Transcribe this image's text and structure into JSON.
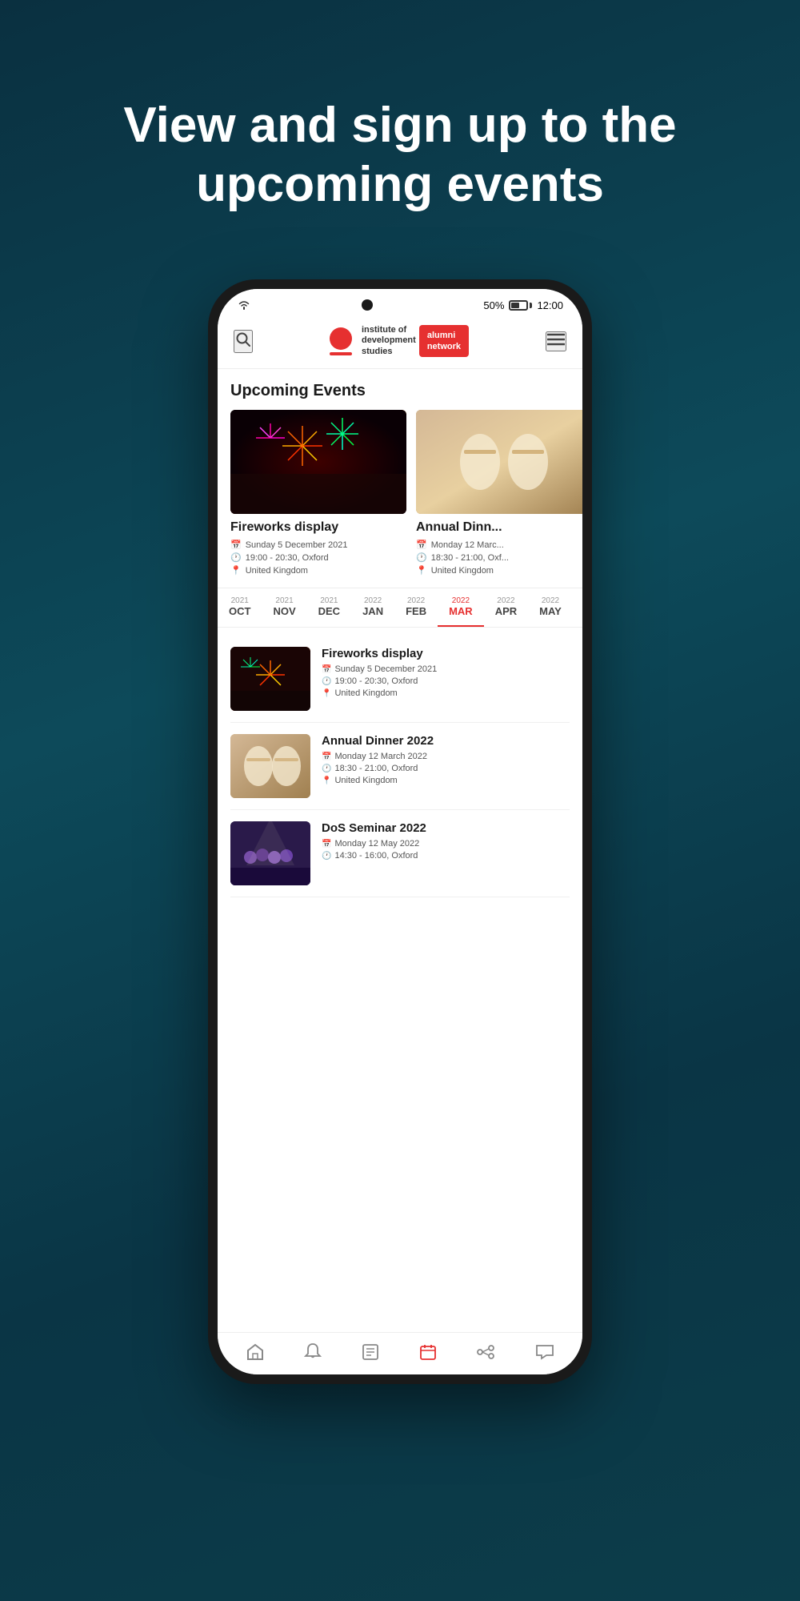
{
  "background": {
    "gradient_start": "#0a3040",
    "gradient_end": "#0c3d4a"
  },
  "hero": {
    "heading": "View and sign up to the upcoming events"
  },
  "status_bar": {
    "time": "12:00",
    "battery": "50%"
  },
  "header": {
    "logo_line1": "institute of",
    "logo_line2": "development",
    "logo_line3": "studies",
    "alumni_line1": "alumni",
    "alumni_line2": "network"
  },
  "upcoming_section": {
    "title": "Upcoming Events"
  },
  "cards": [
    {
      "id": "fireworks",
      "title": "Fireworks display",
      "date": "Sunday 5 December 2021",
      "time_location": "19:00 - 20:30, Oxford",
      "country": "United Kingdom",
      "image_type": "fireworks"
    },
    {
      "id": "annual-dinner",
      "title": "Annual Dinn...",
      "date": "Monday 12 Marc...",
      "time_location": "18:30 - 21:00, Oxf...",
      "country": "United Kingdom",
      "image_type": "dinner"
    }
  ],
  "months": [
    {
      "year": "2021",
      "name": "OCT",
      "active": false
    },
    {
      "year": "2021",
      "name": "NOV",
      "active": false
    },
    {
      "year": "2021",
      "name": "DEC",
      "active": false
    },
    {
      "year": "2022",
      "name": "JAN",
      "active": false
    },
    {
      "year": "2022",
      "name": "FEB",
      "active": false
    },
    {
      "year": "2022",
      "name": "MAR",
      "active": true
    },
    {
      "year": "2022",
      "name": "APR",
      "active": false
    },
    {
      "year": "2022",
      "name": "MAY",
      "active": false
    }
  ],
  "event_list": [
    {
      "id": "fireworks-list",
      "title": "Fireworks display",
      "date": "Sunday 5 December 2021",
      "time_location": "19:00 - 20:30, Oxford",
      "country": "United Kingdom",
      "image_type": "fireworks"
    },
    {
      "id": "annual-dinner-list",
      "title": "Annual Dinner 2022",
      "date": "Monday 12 March 2022",
      "time_location": "18:30 - 21:00, Oxford",
      "country": "United Kingdom",
      "image_type": "dinner"
    },
    {
      "id": "dos-seminar",
      "title": "DoS Seminar 2022",
      "date": "Monday 12 May 2022",
      "time_location": "14:30 - 16:00, Oxford",
      "country": "",
      "image_type": "seminar"
    }
  ],
  "bottom_nav": [
    {
      "icon": "🏠",
      "name": "home",
      "active": false
    },
    {
      "icon": "🔔",
      "name": "notifications",
      "active": false
    },
    {
      "icon": "📋",
      "name": "news",
      "active": false
    },
    {
      "icon": "📅",
      "name": "events",
      "active": false
    },
    {
      "icon": "✳",
      "name": "network",
      "active": false
    },
    {
      "icon": "✉",
      "name": "messages",
      "active": false
    }
  ]
}
